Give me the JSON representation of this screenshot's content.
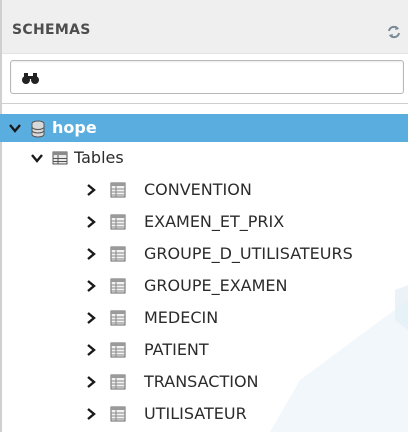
{
  "sidebar": {
    "title": "SCHEMAS",
    "search": {
      "value": "",
      "placeholder": ""
    },
    "schema": {
      "name": "hope",
      "selected": true,
      "expanded": true
    },
    "tables_node": {
      "label": "Tables",
      "expanded": true
    },
    "tables": [
      "CONVENTION",
      "EXAMEN_ET_PRIX",
      "GROUPE_D_UTILISATEURS",
      "GROUPE_EXAMEN",
      "MEDECIN",
      "PATIENT",
      "TRANSACTION",
      "UTILISATEUR"
    ]
  },
  "colors": {
    "header_bg": "#efefef",
    "selection": "#5aaedf",
    "title_text": "#4d4d4d"
  },
  "icons": [
    "refresh-icon",
    "search-icon",
    "database-icon",
    "tables-folder-icon",
    "table-icon",
    "chevron-down-icon",
    "chevron-right-icon"
  ]
}
